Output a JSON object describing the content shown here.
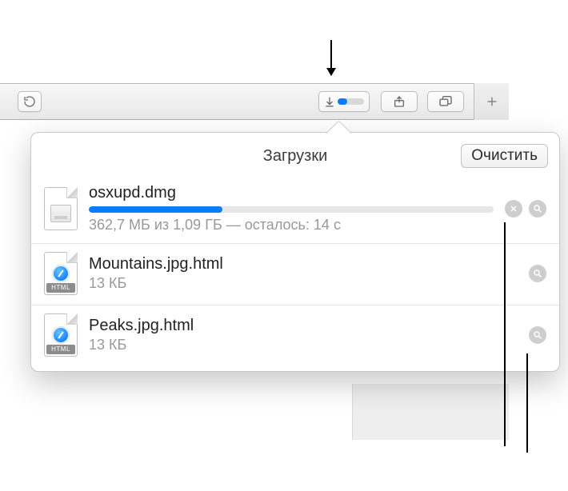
{
  "toolbar": {
    "download_progress_percent": 35
  },
  "popover": {
    "title": "Загрузки",
    "clear_label": "Очистить"
  },
  "downloads": [
    {
      "name": "osxupd.dmg",
      "status": "362,7 МБ из 1,09 ГБ — осталось: 14 с",
      "progress_percent": 33,
      "kind": "dmg",
      "in_progress": true
    },
    {
      "name": "Mountains.jpg.html",
      "status": "13 КБ",
      "kind": "html",
      "in_progress": false
    },
    {
      "name": "Peaks.jpg.html",
      "status": "13 КБ",
      "kind": "html",
      "in_progress": false
    }
  ],
  "icons": {
    "html_badge": "HTML"
  }
}
